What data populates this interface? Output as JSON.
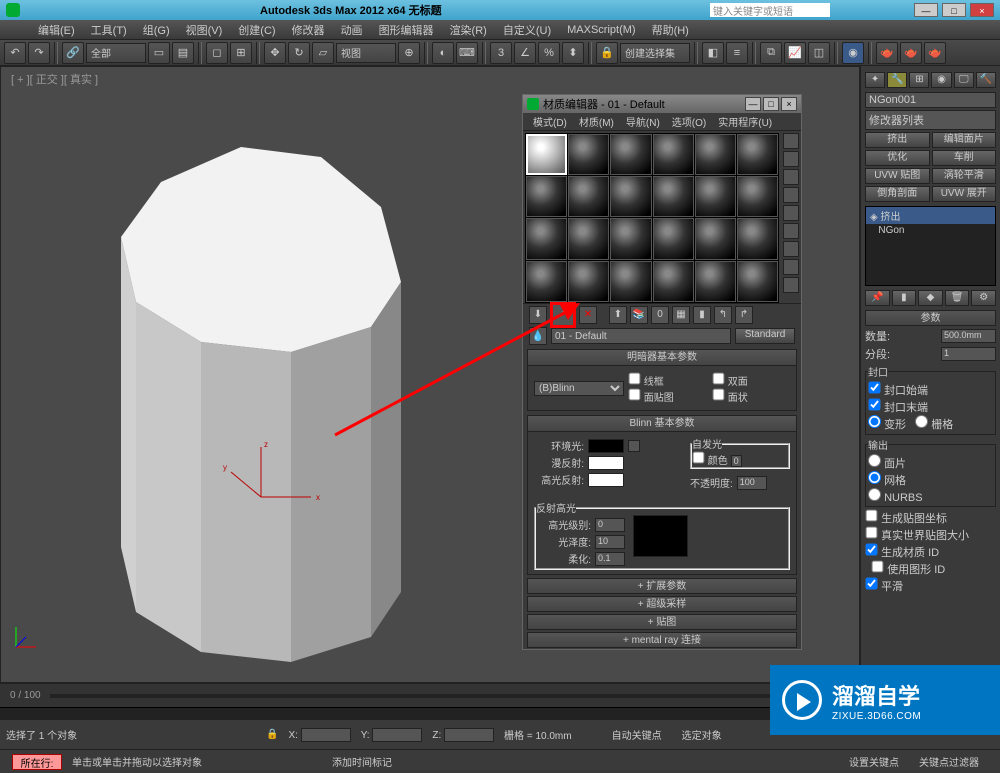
{
  "titlebar": {
    "title": "Autodesk 3ds Max  2012 x64     无标题",
    "search_placeholder": "键入关键字或短语",
    "min": "—",
    "max": "□",
    "close": "×"
  },
  "menubar": [
    "编辑(E)",
    "工具(T)",
    "组(G)",
    "视图(V)",
    "创建(C)",
    "修改器",
    "动画",
    "图形编辑器",
    "渲染(R)",
    "自定义(U)",
    "MAXScript(M)",
    "帮助(H)"
  ],
  "tool_drop1": "全部",
  "tool_drop2": "视图",
  "tool_drop3": "创建选择集",
  "viewport_label": "[ + ][ 正交 ][ 真实 ]",
  "timeslider_range": "0 / 100",
  "mat": {
    "title": "材质编辑器 - 01 - Default",
    "menu": [
      "模式(D)",
      "材质(M)",
      "导航(N)",
      "选项(O)",
      "实用程序(U)"
    ],
    "name": "01 - Default",
    "type_btn": "Standard",
    "shader_head": "明暗器基本参数",
    "shader_value": "(B)Blinn",
    "chk_wire": "线框",
    "chk_2side": "双面",
    "chk_facemap": "面贴图",
    "chk_faceted": "面状",
    "blinn_head": "Blinn 基本参数",
    "ambient": "环境光:",
    "diffuse": "漫反射:",
    "specular": "高光反射:",
    "selfillum_grp": "自发光",
    "selfillum_color": "颜色",
    "selfillum_val": "0",
    "opacity_lbl": "不透明度:",
    "opacity_val": "100",
    "spec_grp": "反射高光",
    "spec_level": "高光级别:",
    "spec_level_v": "0",
    "glossiness": "光泽度:",
    "glossiness_v": "10",
    "soften": "柔化:",
    "soften_v": "0.1",
    "ext": "扩展参数",
    "ss": "超级采样",
    "maps": "贴图",
    "mental": "mental ray 连接"
  },
  "panel": {
    "obj_name": "NGon001",
    "mod_list_lbl": "修改器列表",
    "btns": [
      "挤出",
      "编辑面片",
      "优化",
      "车削",
      "UVW 贴图",
      "涡轮平滑",
      "倒角剖面",
      "UVW 展开"
    ],
    "stack_top": "挤出",
    "stack_sub": "NGon",
    "params_head": "参数",
    "amount_lbl": "数量:",
    "amount_v": "500.0mm",
    "segs_lbl": "分段:",
    "segs_v": "1",
    "cap_grp": "封口",
    "cap_start": "封口始端",
    "cap_end": "封口末端",
    "morph": "变形",
    "grid": "栅格",
    "output_grp": "输出",
    "out_patch": "面片",
    "out_mesh": "网格",
    "out_nurbs": "NURBS",
    "gen_map": "生成贴图坐标",
    "real_world": "真实世界贴图大小",
    "gen_mat": "生成材质 ID",
    "use_shape": "使用图形 ID",
    "smooth": "平滑"
  },
  "status": {
    "sel_count": "选择了 1 个对象",
    "hint": "单击或单击并拖动以选择对象",
    "add_time": "添加时间标记",
    "x": "X:",
    "y": "Y:",
    "z": "Z:",
    "grid": "栅格 = 10.0mm",
    "auto_key": "自动关键点",
    "selected": "选定对象",
    "set_key": "设置关键点",
    "key_filter": "关键点过滤器",
    "current_line": "所在行:"
  },
  "watermark": {
    "cn": "溜溜自学",
    "en": "ZIXUE.3D66.COM"
  }
}
